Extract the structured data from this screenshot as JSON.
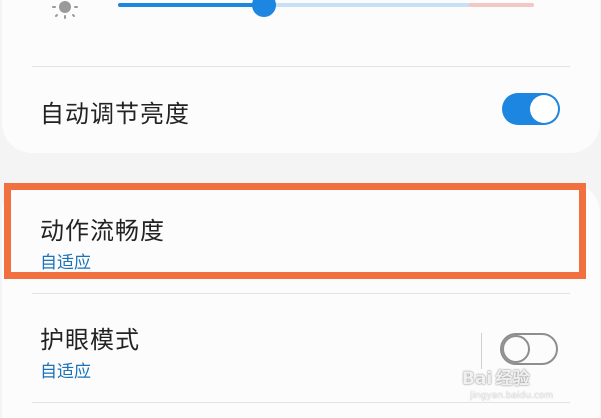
{
  "brightness": {
    "icon": "sun-icon",
    "level": 0.35,
    "accent_color": "#1c86e0"
  },
  "auto_brightness": {
    "label": "自动调节亮度",
    "enabled": true
  },
  "motion_smoothness": {
    "label": "动作流畅度",
    "value": "自适应",
    "highlight_color": "#f2703f"
  },
  "eye_comfort": {
    "label": "护眼模式",
    "value": "自适应",
    "enabled": false
  },
  "watermark": {
    "brand": "Bai 经验",
    "url": "jingyan.baidu.com"
  }
}
